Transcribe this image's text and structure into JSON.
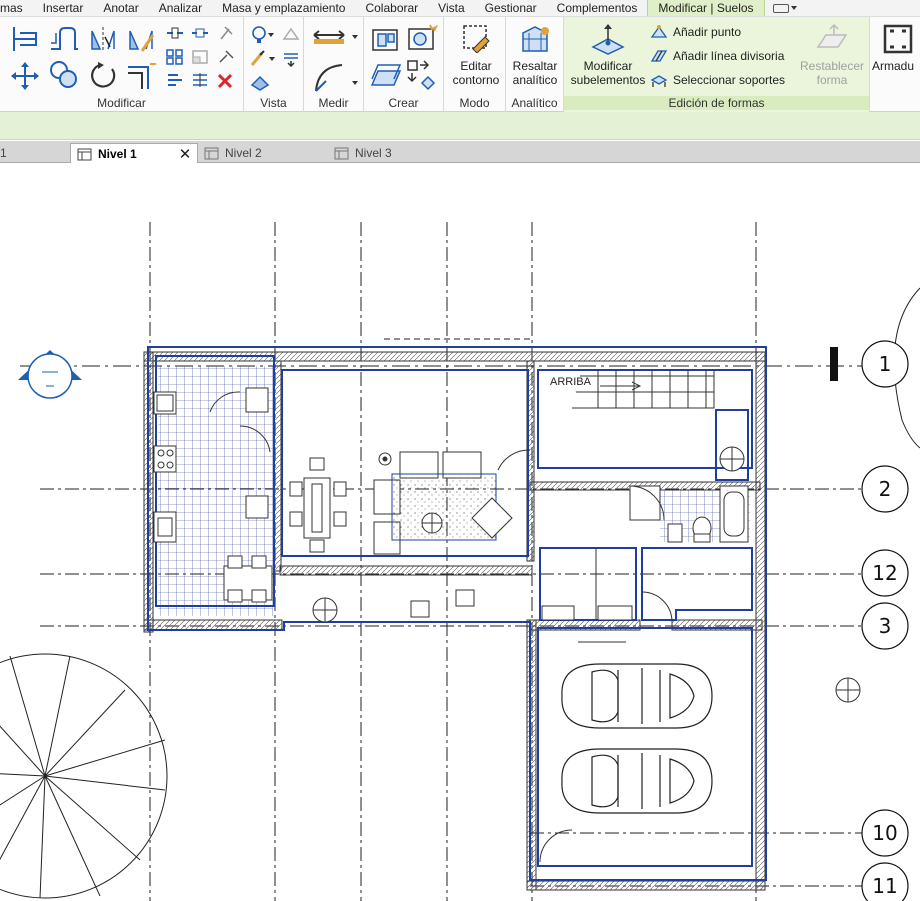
{
  "menu": {
    "tabs": [
      "mas",
      "Insertar",
      "Anotar",
      "Analizar",
      "Masa y emplazamiento",
      "Colaborar",
      "Vista",
      "Gestionar",
      "Complementos",
      "Modificar | Suelos"
    ],
    "active_tab": "Modificar | Suelos"
  },
  "ribbon": {
    "panels": {
      "modificar": "Modificar",
      "vista": "Vista",
      "medir": "Medir",
      "crear": "Crear",
      "modo": "Modo",
      "analitico": "Analítico",
      "edicion": "Edición de formas"
    },
    "buttons": {
      "editar_contorno": "Editar contorno",
      "editar_contorno_l1": "Editar",
      "editar_contorno_l2": "contorno",
      "resaltar_l1": "Resaltar",
      "resaltar_l2": "analítico",
      "modificar_sub_l1": "Modificar",
      "modificar_sub_l2": "subelementos",
      "anadir_punto": "Añadir punto",
      "anadir_linea": "Añadir línea divisoria",
      "seleccionar_soportes": "Seleccionar soportes",
      "restablecer_l1": "Restablecer",
      "restablecer_l2": "forma",
      "armadura": "Armadu"
    }
  },
  "view_tabs": {
    "partial": "1",
    "items": [
      "Nivel 1",
      "Nivel 2",
      "Nivel 3"
    ],
    "active": "Nivel 1"
  },
  "drawing": {
    "stair_label": "ARRIBA",
    "grid_bubbles": [
      "1",
      "2",
      "12",
      "3",
      "10",
      "11"
    ]
  },
  "colors": {
    "ribbon_bg": "#fbfbfb",
    "context_green": "#e3f1d4",
    "selection_blue": "#1f3fa0",
    "icon_blue": "#1e5fb4"
  }
}
